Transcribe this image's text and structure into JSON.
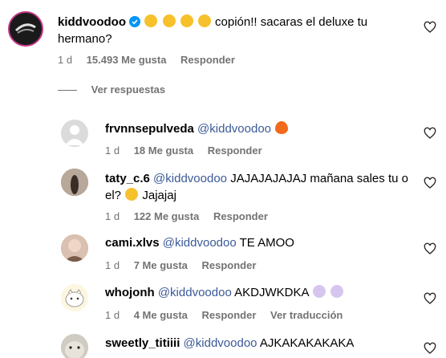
{
  "main_comment": {
    "username": "kiddvoodoo",
    "verified_icon": "verified-badge-icon",
    "text": "copión!! sacaras el deluxe tu hermano?",
    "emojis": [
      "rofl",
      "rofl",
      "rofl",
      "rofl"
    ],
    "time": "1 d",
    "likes": "15.493 Me gusta",
    "reply_label": "Responder",
    "heart_icon": "heart-outline-icon"
  },
  "view_replies_label": "Ver respuestas",
  "replies": [
    {
      "username": "frvnnsepulveda",
      "mention": "@kiddvoodoo",
      "text": "",
      "emoji": "fire",
      "time": "1 d",
      "likes": "18 Me gusta",
      "reply_label": "Responder"
    },
    {
      "username": "taty_c.6",
      "mention": "@kiddvoodoo",
      "text": "JAJAJAJAJAJ mañana sales tu o el?",
      "emoji": "laughing",
      "text_after": "Jajajaj",
      "time": "1 d",
      "likes": "122 Me gusta",
      "reply_label": "Responder"
    },
    {
      "username": "cami.xlvs",
      "mention": "@kiddvoodoo",
      "text": "TE AMOO",
      "time": "1 d",
      "likes": "7 Me gusta",
      "reply_label": "Responder"
    },
    {
      "username": "whojonh",
      "mention": "@kiddvoodoo",
      "text": "AKDJWKDKA",
      "emojis": [
        "purple-heart",
        "purple-heart"
      ],
      "time": "1 d",
      "likes": "4 Me gusta",
      "reply_label": "Responder",
      "translate_label": "Ver traducción"
    },
    {
      "username": "sweetly_titiiii",
      "mention": "@kiddvoodoo",
      "text": "AJKAKAKAKAKA"
    }
  ],
  "colors": {
    "mention": "#3b5998",
    "meta": "#737373"
  }
}
